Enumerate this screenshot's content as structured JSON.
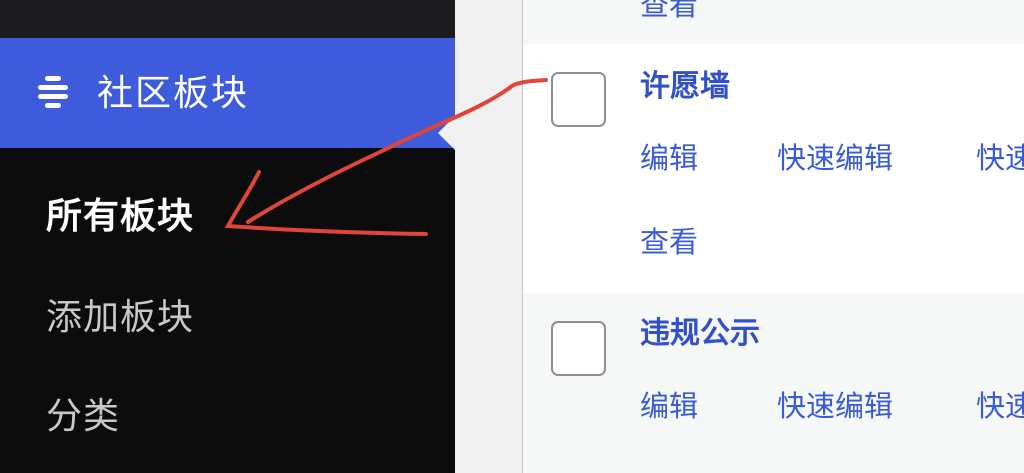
{
  "sidebar": {
    "section": {
      "label": "社区板块",
      "icon": "forum-icon"
    },
    "items": [
      {
        "label": "所有板块",
        "current": true
      },
      {
        "label": "添加板块",
        "current": false
      },
      {
        "label": "分类",
        "current": false
      }
    ]
  },
  "list": {
    "rows": [
      {
        "title": "",
        "actions": {
          "view": "查看"
        }
      },
      {
        "title": "许愿墙",
        "actions": {
          "edit": "编辑",
          "quick_edit": "快速编辑",
          "third": "快速",
          "view": "查看"
        }
      },
      {
        "title": "违规公示",
        "actions": {
          "edit": "编辑",
          "quick_edit": "快速编辑",
          "third": "快速"
        }
      }
    ]
  },
  "colors": {
    "sidebar_bg": "#0c0c0d",
    "active_bg": "#3e5bdc",
    "link": "#3a5bd6",
    "annotation": "#e0453a"
  }
}
